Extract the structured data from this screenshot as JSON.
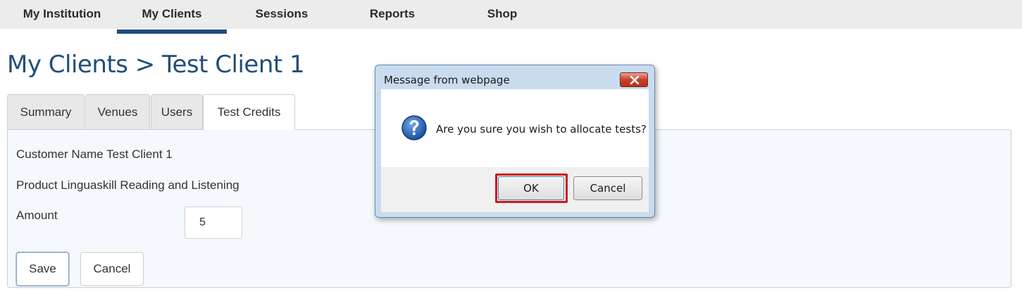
{
  "nav": {
    "items": [
      {
        "label": "My Institution"
      },
      {
        "label": "My Clients"
      },
      {
        "label": "Sessions"
      },
      {
        "label": "Reports"
      },
      {
        "label": "Shop"
      }
    ],
    "active": "My Clients"
  },
  "page": {
    "title": "My Clients > Test Client 1"
  },
  "tabs": [
    {
      "label": "Summary"
    },
    {
      "label": "Venues"
    },
    {
      "label": "Users"
    },
    {
      "label": "Test Credits"
    }
  ],
  "form": {
    "customer_name": "Customer Name Test Client 1",
    "product": "Product Linguaskill Reading and Listening",
    "amount_label": "Amount",
    "amount_value": "5",
    "save_label": "Save",
    "cancel_label": "Cancel"
  },
  "dialog": {
    "title": "Message from webpage",
    "message": "Are you sure you wish to allocate tests?",
    "icon": "question-icon",
    "ok_label": "OK",
    "cancel_label": "Cancel"
  },
  "colors": {
    "brand": "#1f4e79",
    "highlight": "#d0161c"
  }
}
